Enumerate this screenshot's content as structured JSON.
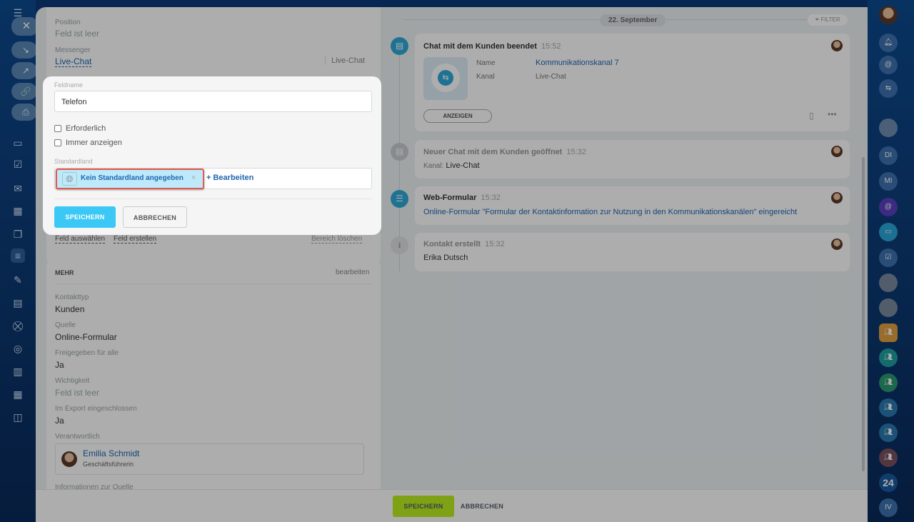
{
  "left_panel": {
    "fields_top": [
      {
        "label": "Position",
        "value": "Feld ist leer",
        "empty": true
      },
      {
        "label": "Messenger",
        "value": "Live-Chat",
        "side": "Live-Chat"
      }
    ],
    "section_links": {
      "select_field": "Feld auswählen",
      "create_field": "Feld erstellen",
      "delete_section": "Bereich löschen"
    },
    "more": {
      "title": "MEHR",
      "edit": "bearbeiten",
      "fields": [
        {
          "label": "Kontakttyp",
          "value": "Kunden"
        },
        {
          "label": "Quelle",
          "value": "Online-Formular"
        },
        {
          "label": "Freigegeben für alle",
          "value": "Ja"
        },
        {
          "label": "Wichtigkeit",
          "value": "Feld ist leer"
        },
        {
          "label": "Im Export eingeschlossen",
          "value": "Ja"
        }
      ],
      "responsible_label": "Verantwortlich",
      "responsible_name": "Emilia Schmidt",
      "responsible_role": "Geschäftsführerin",
      "source_info_label": "Informationen zur Quelle"
    }
  },
  "popup": {
    "field_name_label": "Feldname",
    "field_name_value": "Telefon",
    "required": "Erforderlich",
    "always_show": "Immer anzeigen",
    "default_country_label": "Standardland",
    "country_tag": "Kein Standardland angegeben",
    "tag_remove": "×",
    "edit_link": "+ Bearbeiten",
    "save": "SPEICHERN",
    "cancel": "ABBRECHEN"
  },
  "timeline": {
    "date": "22. September",
    "filter": "FILTER",
    "items": [
      {
        "title": "Chat mit dem Kunden beendet",
        "time": "15:52",
        "name_label": "Name",
        "name_value": "Kommunikationskanal 7",
        "channel_label": "Kanal",
        "channel_value": "Live-Chat",
        "button": "ANZEIGEN"
      },
      {
        "title": "Neuer Chat mit dem Kunden geöffnet",
        "time": "15:32",
        "line_label": "Kanal:",
        "line_value": "Live-Chat"
      },
      {
        "title": "Web-Formular",
        "time": "15:32",
        "text": "Online-Formular \"Formular der Kontaktinformation zur Nutzung in den Kommunikationskanälen\" eingereicht"
      },
      {
        "title": "Kontakt erstellt",
        "time": "15:32",
        "text": "Erika Dutsch"
      }
    ]
  },
  "bottom": {
    "save": "SPEICHERN",
    "cancel": "ABBRECHEN"
  },
  "rightbar": {
    "initials": [
      "DI",
      "MI"
    ],
    "counter": "24",
    "last": "IV"
  },
  "colors": {
    "accent": "#3bc8f5",
    "save_green": "#bbed21",
    "link": "#2067b0"
  }
}
